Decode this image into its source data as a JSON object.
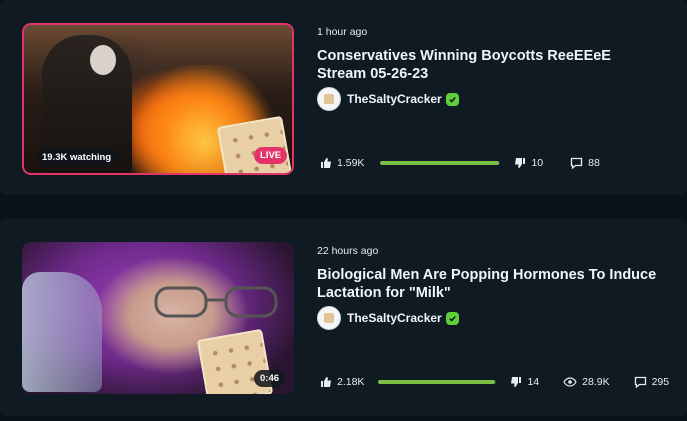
{
  "videos": [
    {
      "time_ago": "1 hour ago",
      "title": "Conservatives Winning Boycotts ReeEEeE Stream 05-26-23",
      "channel": "TheSaltyCracker",
      "watching": "19.3K watching",
      "live_label": "LIVE",
      "likes": "1.59K",
      "dislikes": "10",
      "comments": "88",
      "like_ratio": 0.99
    },
    {
      "time_ago": "22 hours ago",
      "title": "Biological Men Are Popping Hormones To Induce Lactation for \"Milk\"",
      "channel": "TheSaltyCracker",
      "duration": "0:46",
      "likes": "2.18K",
      "dislikes": "14",
      "views": "28.9K",
      "comments": "295",
      "like_ratio": 0.99
    }
  ],
  "colors": {
    "background": "#0b1219",
    "card": "#0f1a23",
    "live": "#e3346a",
    "verified": "#5fcf3a",
    "like_bar": "#7ac143"
  },
  "icons": [
    "thumbs-up-icon",
    "thumbs-down-icon",
    "comment-icon",
    "eye-icon",
    "verified-icon"
  ]
}
